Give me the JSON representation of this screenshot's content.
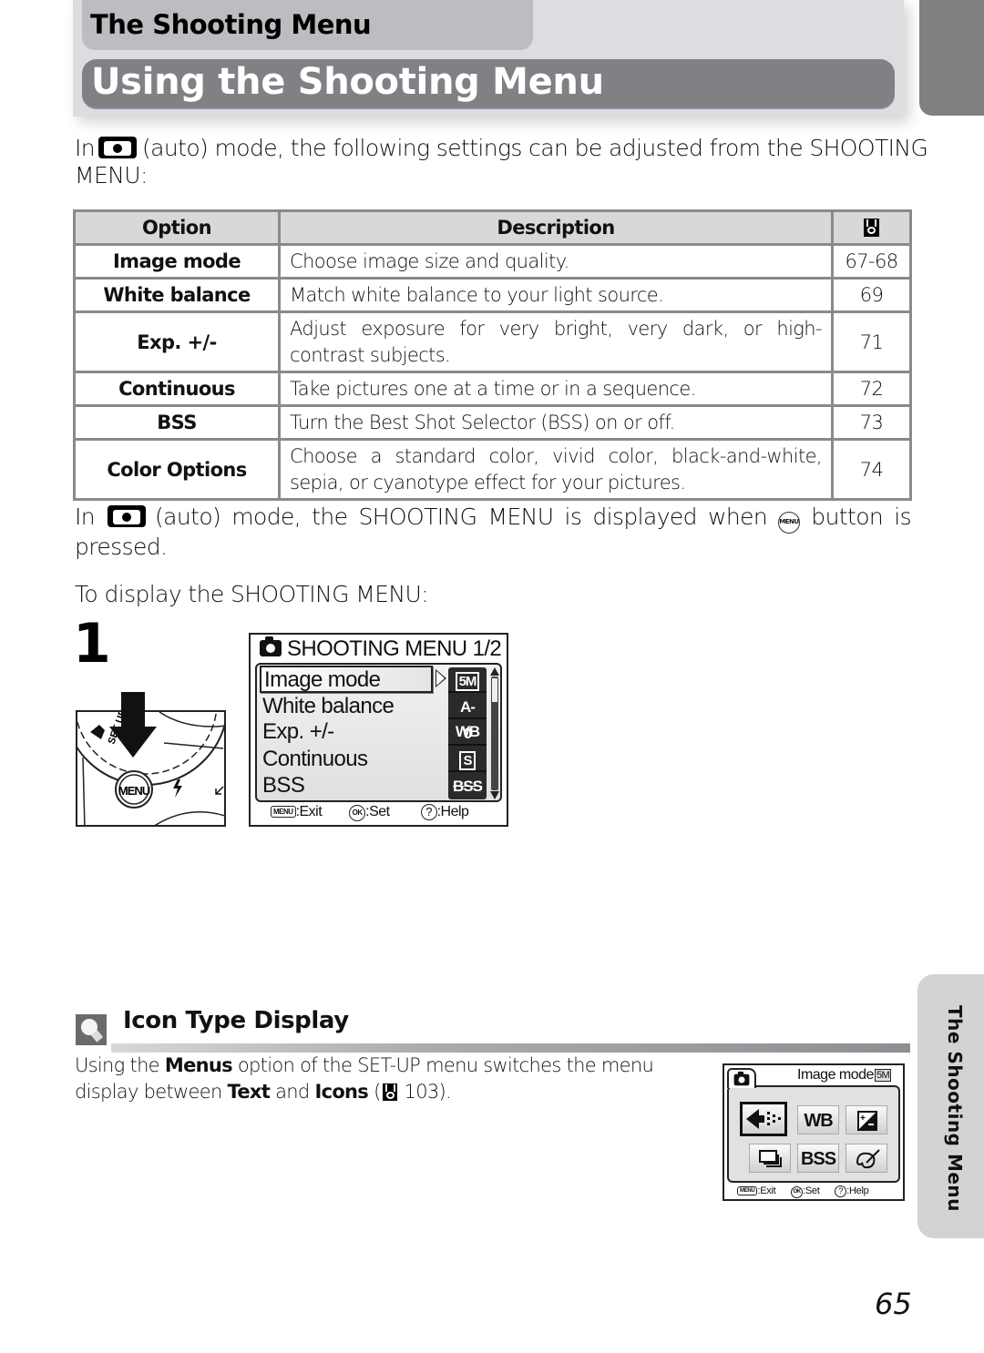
{
  "header": {
    "chapter": "The Shooting Menu",
    "title": "Using the Shooting Menu"
  },
  "intro": {
    "prefix": "In",
    "mode_icon": "auto-mode-camera-icon",
    "text_line1": "(auto) mode, the following settings can be adjusted from the SHOOTING",
    "text_line2": "MENU:"
  },
  "table": {
    "headers": {
      "option": "Option",
      "description": "Description",
      "page_icon": "page-reference-icon"
    },
    "rows": [
      {
        "option": "Image mode",
        "description": "Choose image size and quality.",
        "page": "67-68"
      },
      {
        "option": "White balance",
        "description": "Match white balance to your light source.",
        "page": "69"
      },
      {
        "option": "Exp. +/-",
        "description": "Adjust exposure for very bright, very dark, or high-contrast subjects.",
        "page": "71"
      },
      {
        "option": "Continuous",
        "description": "Take pictures one at a time or in a sequence.",
        "page": "72"
      },
      {
        "option": "BSS",
        "description": "Turn the Best Shot Selector (BSS) on or off.",
        "page": "73"
      },
      {
        "option": "Color Options",
        "description": "Choose a standard color, vivid color, black-and-white, sepia, or cyanotype effect for your pictures.",
        "page": "74"
      }
    ]
  },
  "display_note": {
    "prefix": "In",
    "line1": "(auto) mode, the SHOOTING MENU is displayed when",
    "button_label": "MENU",
    "line1_end": "button is",
    "line2": "pressed."
  },
  "to_display": "To display the SHOOTING MENU:",
  "step": {
    "number": "1",
    "illustration": {
      "menu_button": "MENU",
      "dial_label": "SET UP"
    },
    "screen": {
      "title": "SHOOTING MENU 1/2",
      "items": [
        {
          "label": "Image mode",
          "value": "5M",
          "selected": true
        },
        {
          "label": "White balance",
          "value": "A-WB"
        },
        {
          "label": "Exp. +/-",
          "value": "0"
        },
        {
          "label": "Continuous",
          "value": "S"
        },
        {
          "label": "BSS",
          "value": "BSS"
        }
      ],
      "footer": {
        "exit_key": "MENU",
        "exit": ":Exit",
        "set_key": "OK",
        "set": ":Set",
        "help_key": "?",
        "help": ":Help"
      }
    }
  },
  "tip": {
    "title": "Icon Type Display",
    "text": {
      "p1": "Using the ",
      "b1": "Menus",
      "p2": " option of the SET-UP menu switches the menu display between ",
      "b2": "Text",
      "p3": " and ",
      "b3": "Icons",
      "p4": " (",
      "p5": " 103)."
    },
    "screen": {
      "label": "Image mode",
      "size": "5M",
      "icons": [
        "image-mode",
        "WB",
        "exposure",
        "continuous",
        "BSS",
        "color-options"
      ],
      "wb_text": "WB",
      "bss_text": "BSS",
      "footer": {
        "exit_key": "MENU",
        "exit": ":Exit",
        "set_key": "OK",
        "set": ":Set",
        "help_key": "?",
        "help": ":Help"
      }
    }
  },
  "side_tab": "The Shooting Menu",
  "page_number": "65"
}
